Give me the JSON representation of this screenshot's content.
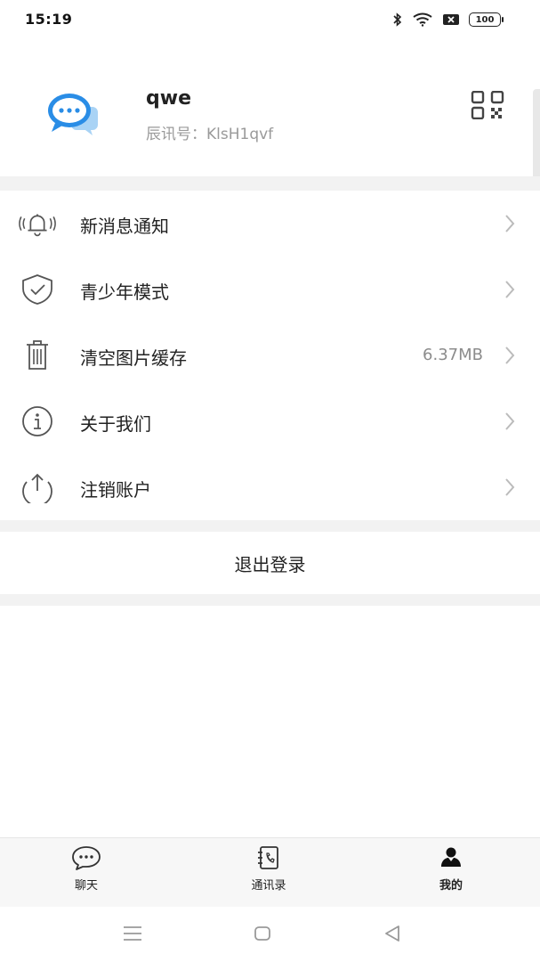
{
  "status_bar": {
    "time": "15:19",
    "battery": "100",
    "icons": [
      "bluetooth-icon",
      "wifi-icon",
      "sim-icon",
      "battery-icon"
    ]
  },
  "profile": {
    "name": "qwe",
    "id_text": "辰讯号：KlsH1qvf",
    "avatar_icon": "chat-bubble-avatar-icon",
    "qr_icon": "qr-code-icon"
  },
  "menu": {
    "items": [
      {
        "label": "新消息通知",
        "value": "",
        "icon": "bell-icon"
      },
      {
        "label": "青少年模式",
        "value": "",
        "icon": "shield-check-icon"
      },
      {
        "label": "清空图片缓存",
        "value": "6.37MB",
        "icon": "trash-icon"
      },
      {
        "label": "关于我们",
        "value": "",
        "icon": "info-icon"
      },
      {
        "label": "注销账户",
        "value": "",
        "icon": "upload-circle-icon"
      }
    ]
  },
  "logout_label": "退出登录",
  "tabbar": {
    "tabs": [
      {
        "label": "聊天",
        "icon": "chat-icon",
        "active": false
      },
      {
        "label": "通讯录",
        "icon": "contacts-book-icon",
        "active": false
      },
      {
        "label": "我的",
        "icon": "person-icon",
        "active": true
      }
    ]
  },
  "colors": {
    "accent_blue": "#2a8de6",
    "band_gray": "#f2f2f2",
    "muted_text": "#9a9a9a"
  }
}
